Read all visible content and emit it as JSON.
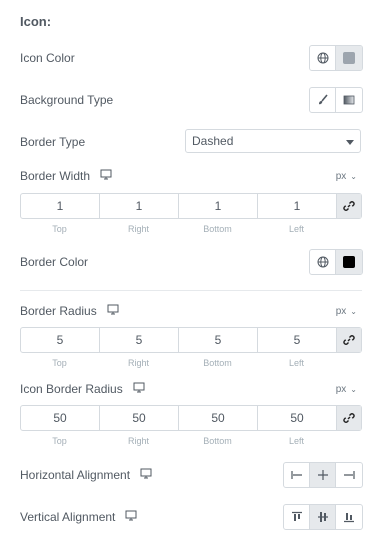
{
  "section": {
    "title": "Icon:"
  },
  "icon_color": {
    "label": "Icon Color",
    "swatch_color": "#9da5ae"
  },
  "background_type": {
    "label": "Background Type"
  },
  "border_type": {
    "label": "Border Type",
    "value": "Dashed"
  },
  "border_width": {
    "label": "Border Width",
    "unit": "px",
    "values": [
      "1",
      "1",
      "1",
      "1"
    ],
    "sides": [
      "Top",
      "Right",
      "Bottom",
      "Left"
    ]
  },
  "border_color": {
    "label": "Border Color",
    "swatch_color": "#000000"
  },
  "border_radius": {
    "label": "Border Radius",
    "unit": "px",
    "values": [
      "5",
      "5",
      "5",
      "5"
    ],
    "sides": [
      "Top",
      "Right",
      "Bottom",
      "Left"
    ]
  },
  "icon_border_radius": {
    "label": "Icon Border Radius",
    "unit": "px",
    "values": [
      "50",
      "50",
      "50",
      "50"
    ],
    "sides": [
      "Top",
      "Right",
      "Bottom",
      "Left"
    ]
  },
  "horizontal_alignment": {
    "label": "Horizontal Alignment",
    "selected": "center"
  },
  "vertical_alignment": {
    "label": "Vertical Alignment",
    "selected": "middle"
  },
  "colors": {
    "border": "#d5dadf",
    "active_bg": "#e6e9ec",
    "text": "#515962",
    "muted": "#a4afb7"
  }
}
